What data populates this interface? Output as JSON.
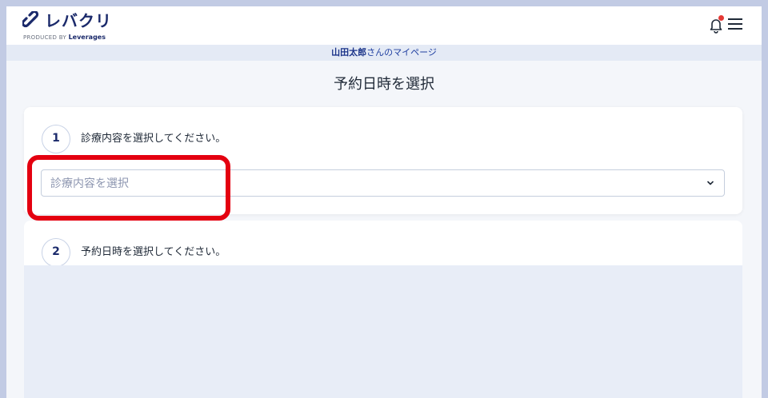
{
  "header": {
    "logo_text": "レバクリ",
    "logo_sub_prefix": "PRODUCED BY",
    "logo_sub_brand": "Leverages",
    "notification_icon": "bell-icon",
    "menu_icon": "hamburger-menu-icon"
  },
  "subbar": {
    "user_name": "山田太郎",
    "suffix": "さんのマイページ"
  },
  "page": {
    "title": "予約日時を選択"
  },
  "steps": [
    {
      "number": "1",
      "label": "診療内容を選択してください。",
      "select_placeholder": "診療内容を選択"
    },
    {
      "number": "2",
      "label": "予約日時を選択してください。"
    }
  ],
  "colors": {
    "brand": "#1b2a6b",
    "accent_link": "#1f3fa0",
    "highlight": "#e40010",
    "notification_dot": "#e53935"
  }
}
